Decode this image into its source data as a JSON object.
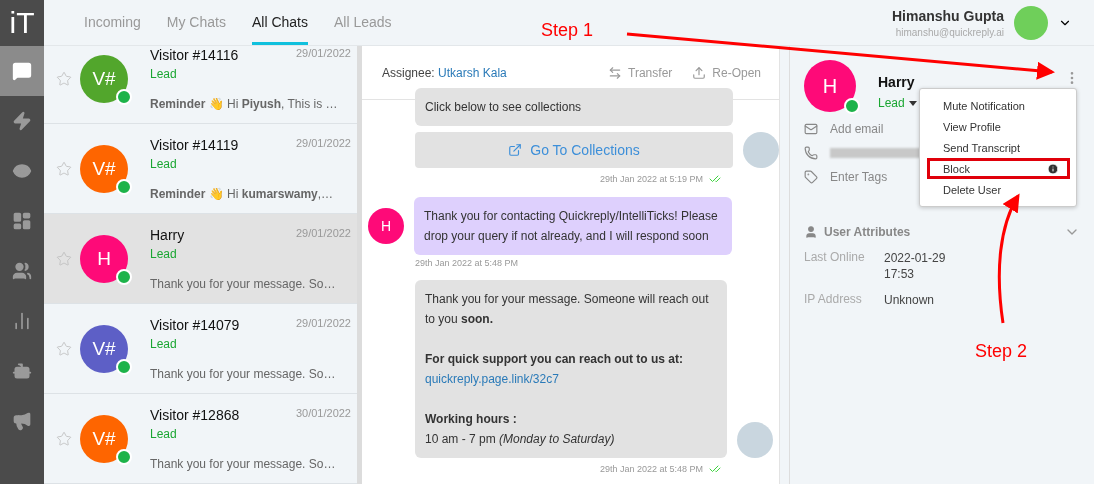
{
  "logo": "iT",
  "nav": [
    {
      "selected": true
    },
    {
      "selected": false
    },
    {
      "selected": false
    },
    {
      "selected": false
    },
    {
      "selected": false
    },
    {
      "selected": false
    },
    {
      "selected": false
    },
    {
      "selected": false
    }
  ],
  "tabs": [
    {
      "label": "Incoming",
      "selected": false
    },
    {
      "label": "My Chats",
      "selected": false
    },
    {
      "label": "All Chats",
      "selected": true
    },
    {
      "label": "All Leads",
      "selected": false
    }
  ],
  "user": {
    "name": "Himanshu Gupta",
    "email": "himanshu@quickreply.ai"
  },
  "chats": [
    {
      "initials": "V#",
      "color": "#52a62c",
      "name": "Visitor #14116",
      "date": "29/01/2022",
      "tag": "Lead",
      "preview": "**Reminder** 👋 Hi **Piyush**, This is …",
      "starred": false,
      "selected": false
    },
    {
      "initials": "V#",
      "color": "#fe6500",
      "name": "Visitor #14119",
      "date": "29/01/2022",
      "tag": "Lead",
      "preview": "**Reminder** 👋 Hi **kumarswamy**,…",
      "starred": false,
      "selected": false
    },
    {
      "initials": "H",
      "color": "#fe0a78",
      "name": "Harry",
      "date": "29/01/2022",
      "tag": "Lead",
      "preview": "Thank you for your message. So…",
      "starred": false,
      "selected": true
    },
    {
      "initials": "V#",
      "color": "#5d5fc6",
      "name": "Visitor #14079",
      "date": "29/01/2022",
      "tag": "Lead",
      "preview": "Thank you for your message. So…",
      "starred": false,
      "selected": false
    },
    {
      "initials": "V#",
      "color": "#fe6500",
      "name": "Visitor #12868",
      "date": "30/01/2022",
      "tag": "Lead",
      "preview": "Thank you for your message. So…",
      "starred": false,
      "selected": false
    }
  ],
  "conversation": {
    "assignee_label": "Assignee:",
    "assignee": "Utkarsh Kala",
    "actions": [
      "Transfer",
      "Re-Open"
    ],
    "messages": [
      {
        "kind": "agent",
        "blocks": [
          {
            "kind": "text",
            "text": "Click below to see collections"
          }
        ],
        "button": "Go To Collections",
        "time": "29th Jan 2022 at 5:19 PM",
        "read": true
      },
      {
        "kind": "visitor",
        "initial": "H",
        "blocks": [
          {
            "kind": "text",
            "text": "Thank you for contacting Quickreply/IntelliTicks! Please drop your query if not already, and I will respond soon"
          }
        ],
        "time": "29th Jan 2022 at 5:48 PM"
      },
      {
        "kind": "agent",
        "blocks": [
          {
            "kind": "text",
            "text": "Thank you for your message. Someone will reach out to you **soon.**"
          },
          {
            "kind": "gap"
          },
          {
            "kind": "heading",
            "text": "For quick support you can reach out to us at:"
          },
          {
            "kind": "link",
            "text": "quickreply.page.link/32c7"
          },
          {
            "kind": "gap"
          },
          {
            "kind": "heading",
            "text": "Working hours :"
          },
          {
            "kind": "text",
            "text": "10 am - 7 pm *(Monday to Saturday)*"
          }
        ],
        "time": "29th Jan 2022 at 5:48 PM",
        "read": true
      }
    ]
  },
  "profile": {
    "initial": "H",
    "name": "Harry",
    "tag": "Lead",
    "email_placeholder": "Add email",
    "tags_placeholder": "Enter Tags",
    "attributes_title": "User Attributes",
    "attributes": [
      {
        "label": "Last Online",
        "value": "2022-01-29\n17:53"
      },
      {
        "label": "IP Address",
        "value": "Unknown"
      }
    ]
  },
  "menu": [
    {
      "label": "Mute Notification",
      "highlighted": false
    },
    {
      "label": "View Profile",
      "highlighted": false
    },
    {
      "label": "Send Transcript",
      "highlighted": false
    },
    {
      "label": "Block",
      "highlighted": true,
      "info": true
    },
    {
      "label": "Delete User",
      "highlighted": false
    }
  ],
  "annotations": [
    "Step 1",
    "Step 2"
  ]
}
